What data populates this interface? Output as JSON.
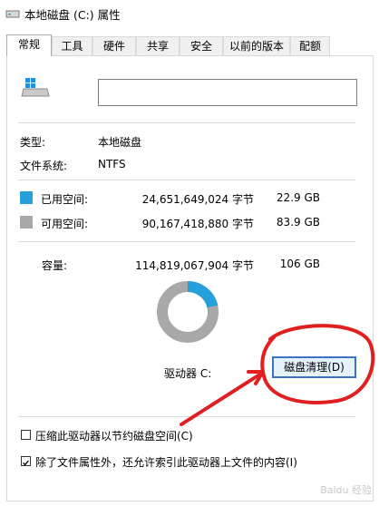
{
  "window": {
    "title": "本地磁盘 (C:) 属性",
    "icon": "drive-icon"
  },
  "tabs": [
    {
      "label": "常规",
      "active": true
    },
    {
      "label": "工具"
    },
    {
      "label": "硬件"
    },
    {
      "label": "共享"
    },
    {
      "label": "安全"
    },
    {
      "label": "以前的版本"
    },
    {
      "label": "配额"
    }
  ],
  "general": {
    "drive_icon": "windows-drive-icon",
    "name_value": "",
    "type_label": "类型:",
    "type_value": "本地磁盘",
    "fs_label": "文件系统:",
    "fs_value": "NTFS",
    "used": {
      "label": "已用空间:",
      "bytes": "24,651,649,024 字节",
      "size": "22.9 GB",
      "color": "#26a0da"
    },
    "free": {
      "label": "可用空间:",
      "bytes": "90,167,418,880 字节",
      "size": "83.9 GB",
      "color": "#a8a8a8"
    },
    "capacity": {
      "label": "容量:",
      "bytes": "114,819,067,904 字节",
      "size": "106 GB"
    },
    "used_fraction": 0.215,
    "drive_label": "驱动器 C:",
    "cleanup_button": "磁盘清理(D)",
    "compress_label": "压缩此驱动器以节约磁盘空间(C)",
    "compress_checked": false,
    "index_label": "除了文件属性外，还允许索引此驱动器上文件的内容(I)",
    "index_checked": true
  },
  "annotation": {
    "color": "#e02020",
    "type": "hand-drawn circle and arrow"
  },
  "watermark": "Baidu 经验"
}
